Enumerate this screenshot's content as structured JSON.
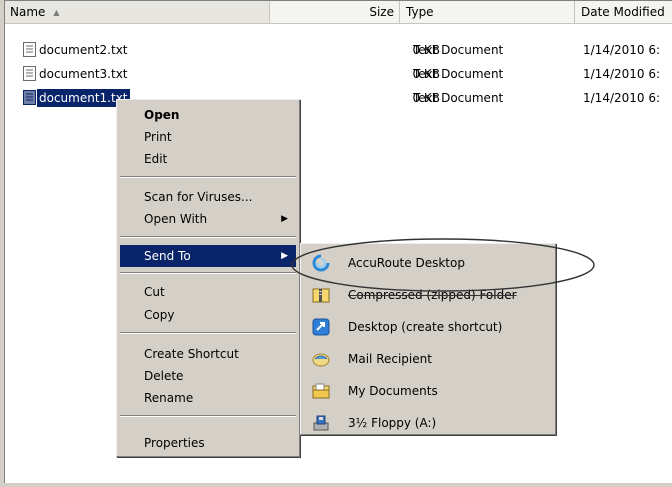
{
  "header": {
    "name": "Name",
    "size": "Size",
    "type": "Type",
    "date": "Date Modified"
  },
  "files": [
    {
      "name": "document2.txt",
      "size": "0 KB",
      "type": "Text Document",
      "date": "1/14/2010 6:"
    },
    {
      "name": "document3.txt",
      "size": "0 KB",
      "type": "Text Document",
      "date": "1/14/2010 6:"
    },
    {
      "name": "document1.txt",
      "size": "0 KB",
      "type": "Text Document",
      "date": "1/14/2010 6:"
    }
  ],
  "context_menu": {
    "open": "Open",
    "print": "Print",
    "edit": "Edit",
    "scan": "Scan for Viruses...",
    "open_with": "Open With",
    "send_to": "Send To",
    "cut": "Cut",
    "copy": "Copy",
    "create_shortcut": "Create Shortcut",
    "delete": "Delete",
    "rename": "Rename",
    "properties": "Properties"
  },
  "send_to_menu": {
    "accuroute": "AccuRoute Desktop",
    "compressed": "Compressed (zipped) Folder",
    "desktop": "Desktop (create shortcut)",
    "mail": "Mail Recipient",
    "my_documents": "My Documents",
    "floppy": "3½ Floppy (A:)"
  },
  "colors": {
    "selection": "#0a246a",
    "menu_bg": "#d4d0c8",
    "highlight_ellipse": "#333333"
  }
}
